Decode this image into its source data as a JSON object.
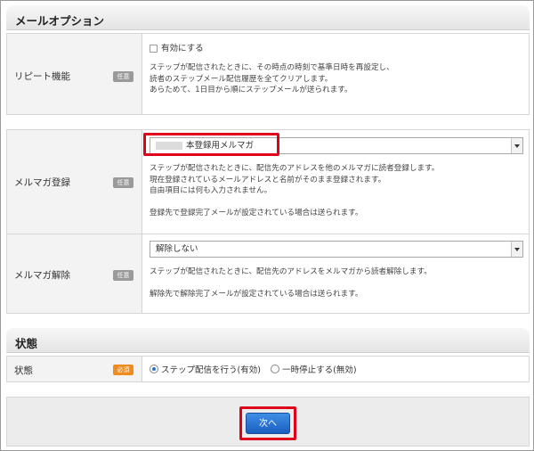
{
  "sections": {
    "mail_option": {
      "title": "メールオプション"
    },
    "status": {
      "title": "状態"
    }
  },
  "repeat": {
    "label": "リピート機能",
    "badge": "任意",
    "checkbox_label": "有効にする",
    "desc": [
      "ステップが配信されたときに、その時点の時刻で基準日時を再設定し、",
      "読者のステップメール配信履歴を全てクリアします。",
      "あらためて、1日目から順にステップメールが送られます。"
    ]
  },
  "mailmag_register": {
    "label": "メルマガ登録",
    "badge": "任意",
    "selected": "本登録用メルマガ",
    "desc": [
      "ステップが配信されたときに、配信先のアドレスを他のメルマガに読者登録します。",
      "現在登録されているメールアドレスと名前がそのまま登録されます。",
      "自由項目には何も入力されません。",
      "",
      "登録先で登録完了メールが設定されている場合は送られます。"
    ]
  },
  "mailmag_cancel": {
    "label": "メルマガ解除",
    "badge": "任意",
    "selected": "解除しない",
    "desc": [
      "ステップが配信されたときに、配信先のアドレスをメルマガから読者解除します。",
      "",
      "解除先で解除完了メールが設定されている場合は送られます。"
    ]
  },
  "status_row": {
    "label": "状態",
    "badge": "必須",
    "options": [
      "ステップ配信を行う(有効)",
      "一時停止する(無効)"
    ],
    "selected_index": 0
  },
  "footer": {
    "next_label": "次へ"
  },
  "colors": {
    "highlight": "#e0001a",
    "button": "#1a5fbe",
    "required_badge": "#f08c1e"
  }
}
